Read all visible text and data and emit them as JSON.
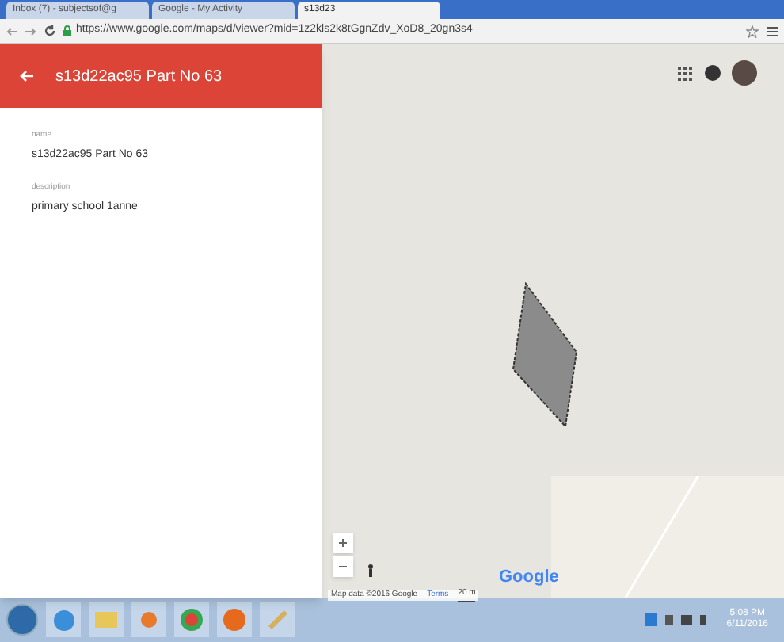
{
  "browser": {
    "tabs": [
      {
        "title": "Inbox (7) - subjectsof@g",
        "selected": false
      },
      {
        "title": "Google - My Activity",
        "selected": false
      },
      {
        "title": "s13d23",
        "selected": true
      }
    ],
    "url": "https://www.google.com/maps/d/viewer?mid=1z2kls2k8tGgnZdv_XoD8_20gn3s4"
  },
  "panel": {
    "title": "s13d22ac95 Part No 63",
    "fields": [
      {
        "label": "name",
        "value": "s13d22ac95 Part No 63"
      },
      {
        "label": "description",
        "value": "primary school 1anne"
      }
    ]
  },
  "map": {
    "logo": "Google",
    "attribution": "Map data ©2016 Google",
    "terms": "Terms",
    "scale": "20 m"
  },
  "taskbar": {
    "time": "5:08 PM",
    "date": "6/11/2016"
  }
}
